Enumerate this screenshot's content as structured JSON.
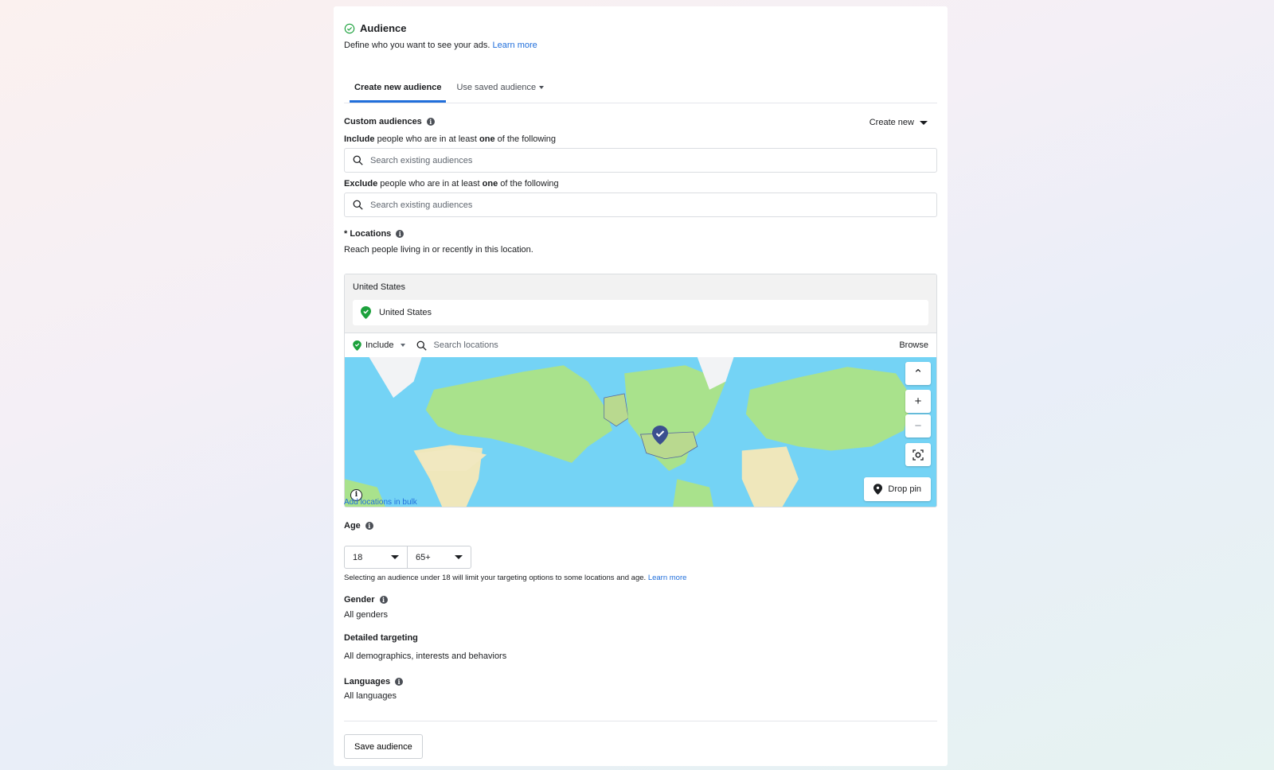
{
  "header": {
    "title": "Audience",
    "description": "Define who you want to see your ads.",
    "learn_more": "Learn more"
  },
  "tabs": [
    {
      "label": "Create new audience",
      "active": true
    },
    {
      "label": "Use saved audience",
      "active": false
    }
  ],
  "custom_audiences": {
    "label": "Custom audiences",
    "create_new": "Create new",
    "include_bold": "Include",
    "include_text_1": " people who are in at least ",
    "include_one": "one",
    "include_text_2": " of the following",
    "exclude_bold": "Exclude",
    "exclude_text_1": " people who are in at least ",
    "exclude_one": "one",
    "exclude_text_2": " of the following",
    "include_placeholder": "Search existing audiences",
    "exclude_placeholder": "Search existing audiences"
  },
  "locations": {
    "label": "* Locations",
    "description": "Reach people living in or recently in this location.",
    "group_title": "United States",
    "selected": [
      "United States"
    ],
    "mode": "Include",
    "search_placeholder": "Search locations",
    "browse": "Browse",
    "drop_pin": "Drop pin",
    "add_bulk": "Add locations in bulk"
  },
  "age": {
    "label": "Age",
    "min": "18",
    "max": "65+",
    "note": "Selecting an audience under 18 will limit your targeting options to some locations and age.",
    "learn_more": "Learn more"
  },
  "gender": {
    "label": "Gender",
    "value": "All genders"
  },
  "detailed_targeting": {
    "label": "Detailed targeting",
    "value": "All demographics, interests and behaviors"
  },
  "languages": {
    "label": "Languages",
    "value": "All languages"
  },
  "footer": {
    "save_label": "Save audience"
  },
  "colors": {
    "accent": "#216fdb",
    "success": "#1ca13c",
    "pin": "#3b4f8f"
  }
}
